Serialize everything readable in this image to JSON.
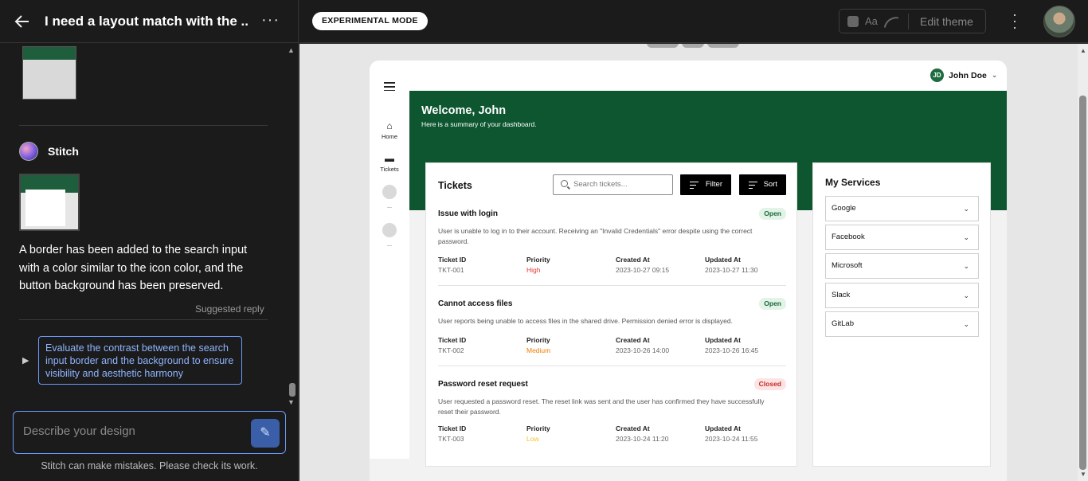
{
  "left_panel": {
    "title": "I need a layout match with the ...",
    "assistant_name": "Stitch",
    "message": "A border has been added to the search input with a color similar to the icon color, and the button background has been preserved.",
    "suggested_reply_label": "Suggested reply",
    "suggestion": "Evaluate the contrast between the search input border and the background to ensure visibility and aesthetic harmony",
    "prompt_placeholder": "Describe your design",
    "disclaimer": "Stitch can make mistakes. Please check its work."
  },
  "topbar": {
    "mode_badge": "EXPERIMENTAL MODE",
    "font_label": "Aa",
    "edit_theme": "Edit theme"
  },
  "preview": {
    "user": {
      "initials": "JD",
      "name": "John Doe"
    },
    "sidebar": [
      {
        "icon": "home-icon",
        "label": "Home"
      },
      {
        "icon": "ticket-icon",
        "label": "Tickets"
      }
    ],
    "hero": {
      "title": "Welcome, John",
      "subtitle": "Here is a summary of your dashboard."
    },
    "tickets_panel": {
      "title": "Tickets",
      "search_placeholder": "Search tickets...",
      "filter_label": "Filter",
      "sort_label": "Sort",
      "column_labels": {
        "id": "Ticket ID",
        "priority": "Priority",
        "created": "Created At",
        "updated": "Updated At"
      },
      "items": [
        {
          "title": "Issue with login",
          "status": "Open",
          "description": "User is unable to log in to their account. Receiving an \"Invalid Credentials\" error despite using the correct password.",
          "id": "TKT-001",
          "priority": "High",
          "created": "2023-10-27 09:15",
          "updated": "2023-10-27 11:30"
        },
        {
          "title": "Cannot access files",
          "status": "Open",
          "description": "User reports being unable to access files in the shared drive. Permission denied error is displayed.",
          "id": "TKT-002",
          "priority": "Medium",
          "created": "2023-10-26 14:00",
          "updated": "2023-10-26 16:45"
        },
        {
          "title": "Password reset request",
          "status": "Closed",
          "description": "User requested a password reset. The reset link was sent and the user has confirmed they have successfully reset their password.",
          "id": "TKT-003",
          "priority": "Low",
          "created": "2023-10-24 11:20",
          "updated": "2023-10-24 11:55"
        }
      ]
    },
    "services_panel": {
      "title": "My Services",
      "items": [
        "Google",
        "Facebook",
        "Microsoft",
        "Slack",
        "GitLab"
      ]
    }
  },
  "colors": {
    "brand_green": "#0d5630",
    "priority_high": "#e53935",
    "priority_medium": "#f57c00",
    "priority_low": "#fbc02d",
    "link_blue": "#6a9bff"
  }
}
